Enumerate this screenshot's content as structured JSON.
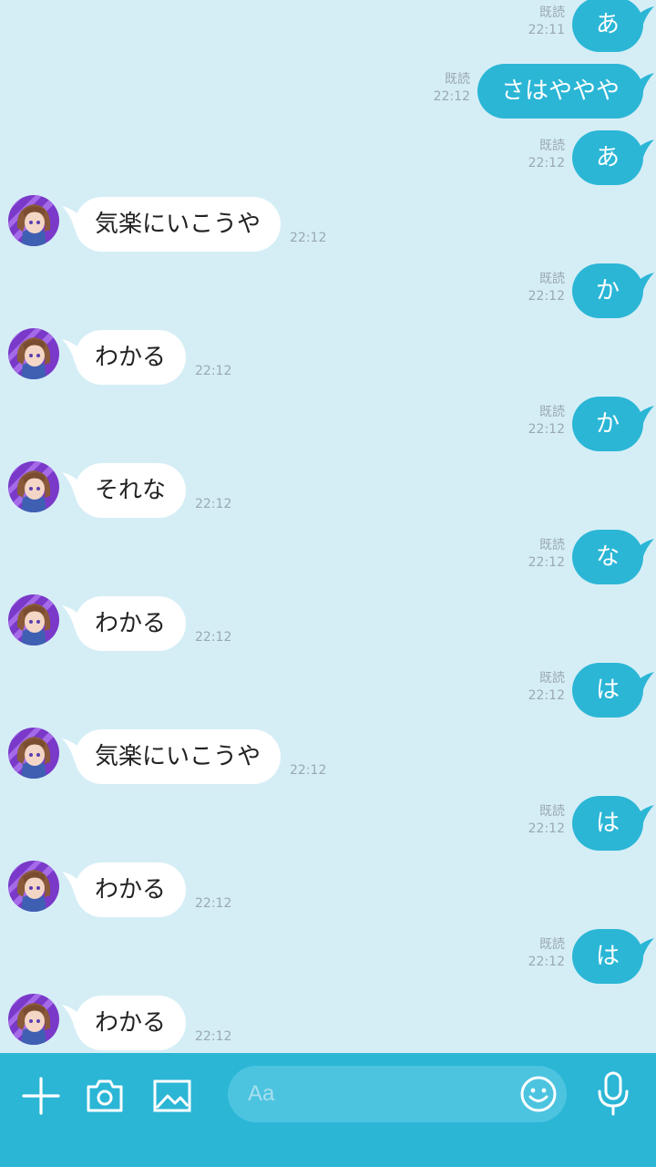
{
  "colors": {
    "background": "#d5eef6",
    "outgoing_bubble": "#2bb6d6",
    "incoming_bubble": "#ffffff",
    "input_bar": "#2bb6d6"
  },
  "messages": [
    {
      "side": "out",
      "text": "あ",
      "read": "既読",
      "time": "22:11"
    },
    {
      "side": "out",
      "text": "さはややや",
      "read": "既読",
      "time": "22:12"
    },
    {
      "side": "out",
      "text": "あ",
      "read": "既読",
      "time": "22:12"
    },
    {
      "side": "in",
      "text": "気楽にいこうや",
      "time": "22:12"
    },
    {
      "side": "out",
      "text": "か",
      "read": "既読",
      "time": "22:12"
    },
    {
      "side": "in",
      "text": "わかる",
      "time": "22:12"
    },
    {
      "side": "out",
      "text": "か",
      "read": "既読",
      "time": "22:12"
    },
    {
      "side": "in",
      "text": "それな",
      "time": "22:12"
    },
    {
      "side": "out",
      "text": "な",
      "read": "既読",
      "time": "22:12"
    },
    {
      "side": "in",
      "text": "わかる",
      "time": "22:12"
    },
    {
      "side": "out",
      "text": "は",
      "read": "既読",
      "time": "22:12"
    },
    {
      "side": "in",
      "text": "気楽にいこうや",
      "time": "22:12"
    },
    {
      "side": "out",
      "text": "は",
      "read": "既読",
      "time": "22:12"
    },
    {
      "side": "in",
      "text": "わかる",
      "time": "22:12"
    },
    {
      "side": "out",
      "text": "は",
      "read": "既読",
      "time": "22:12"
    },
    {
      "side": "in",
      "text": "わかる",
      "time": "22:12"
    }
  ],
  "input_bar": {
    "placeholder": "Aa",
    "icons": [
      "plus-icon",
      "camera-icon",
      "image-icon",
      "emoji-icon",
      "microphone-icon"
    ]
  }
}
